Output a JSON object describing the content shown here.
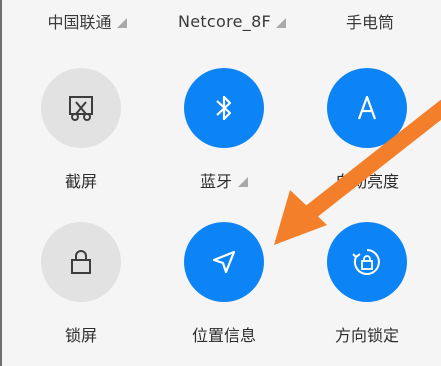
{
  "status_row": {
    "carrier": "中国联通",
    "wifi": "Netcore_8F",
    "flashlight": "手电筒"
  },
  "tiles": [
    {
      "label": "截屏",
      "active": false,
      "icon": "screenshot-icon"
    },
    {
      "label": "蓝牙",
      "active": true,
      "icon": "bluetooth-icon"
    },
    {
      "label": "自动亮度",
      "active": true,
      "icon": "auto-brightness-icon"
    },
    {
      "label": "锁屏",
      "active": false,
      "icon": "lock-icon"
    },
    {
      "label": "位置信息",
      "active": true,
      "icon": "location-icon"
    },
    {
      "label": "方向锁定",
      "active": true,
      "icon": "rotation-lock-icon"
    }
  ],
  "colors": {
    "active_blue": "#0d84f6",
    "inactive_gray": "#e2e2e2",
    "annotation_arrow": "#f47f2a"
  }
}
